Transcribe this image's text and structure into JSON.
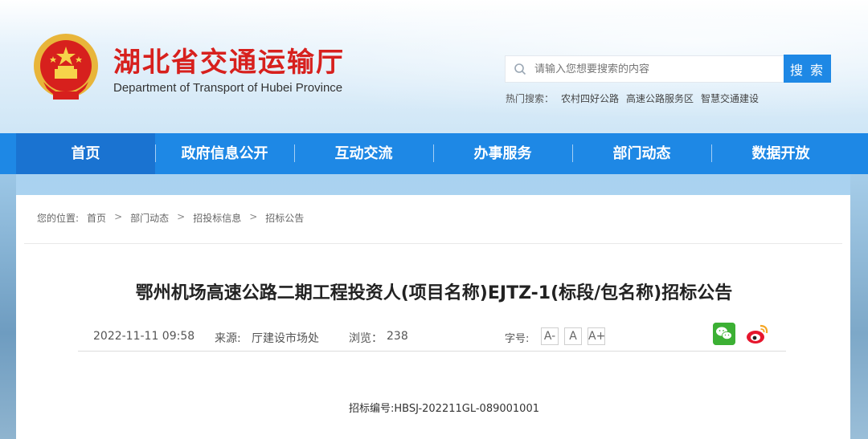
{
  "header": {
    "title": "湖北省交通运输厅",
    "subtitle": "Department of Transport of Hubei Province",
    "search": {
      "placeholder": "请输入您想要搜索的内容",
      "button_label": "搜 索"
    },
    "hot_search": {
      "label": "热门搜索：",
      "items": [
        "农村四好公路",
        "高速公路服务区",
        "智慧交通建设"
      ]
    }
  },
  "nav": {
    "items": [
      {
        "label": "首页",
        "active": true
      },
      {
        "label": "政府信息公开"
      },
      {
        "label": "互动交流"
      },
      {
        "label": "办事服务"
      },
      {
        "label": "部门动态"
      },
      {
        "label": "数据开放"
      }
    ]
  },
  "breadcrumb": {
    "label": "您的位置:",
    "items": [
      "首页",
      "部门动态",
      "招投标信息",
      "招标公告"
    ],
    "separator": ">"
  },
  "article": {
    "title": "鄂州机场高速公路二期工程投资人(项目名称)EJTZ-1(标段/包名称)招标公告",
    "date": "2022-11-11 09:58",
    "source_label": "来源:",
    "source": "厅建设市场处",
    "views_label": "浏览：",
    "views": "238",
    "font_size_label": "字号:",
    "font_sizes": [
      "A-",
      "A",
      "A+"
    ],
    "bid_number": "招标编号:HBSJ-202211GL-089001001"
  },
  "colors": {
    "brand_red": "#d7201d",
    "nav_blue": "#1e88e5",
    "wechat_green": "#3cb034"
  }
}
